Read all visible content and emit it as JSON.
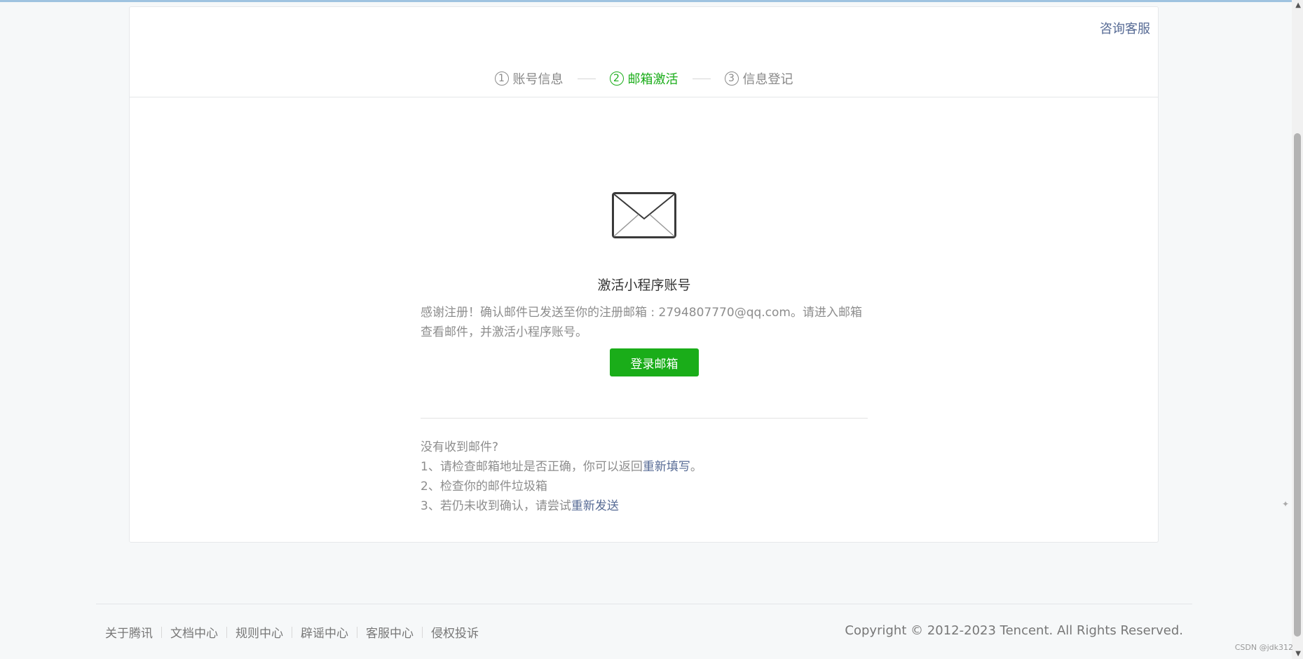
{
  "header": {
    "help_link": "咨询客服",
    "steps": [
      {
        "num": "1",
        "label": "账号信息",
        "active": false
      },
      {
        "num": "2",
        "label": "邮箱激活",
        "active": true
      },
      {
        "num": "3",
        "label": "信息登记",
        "active": false
      }
    ]
  },
  "main": {
    "icon": "envelope-icon",
    "title": "激活小程序账号",
    "description": "感谢注册！确认邮件已发送至你的注册邮箱 : 2794807770@qq.com。请进入邮箱查看邮件，并激活小程序账号。",
    "login_button": "登录邮箱",
    "help_title": "没有收到邮件?",
    "help_1_text": "1、请检查邮箱地址是否正确，你可以返回",
    "help_1_link": "重新填写",
    "help_1_end": "。",
    "help_2_text": "2、检查你的邮件垃圾箱",
    "help_3_text": "3、若仍未收到确认，请尝试",
    "help_3_link": "重新发送"
  },
  "footer": {
    "links": [
      "关于腾讯",
      "文档中心",
      "规则中心",
      "辟谣中心",
      "客服中心",
      "侵权投诉"
    ],
    "copyright": "Copyright © 2012-2023 Tencent. All Rights Reserved."
  },
  "watermark": "CSDN @jdk312",
  "colors": {
    "accent_green": "#1aad19",
    "link_blue": "#576b95"
  }
}
